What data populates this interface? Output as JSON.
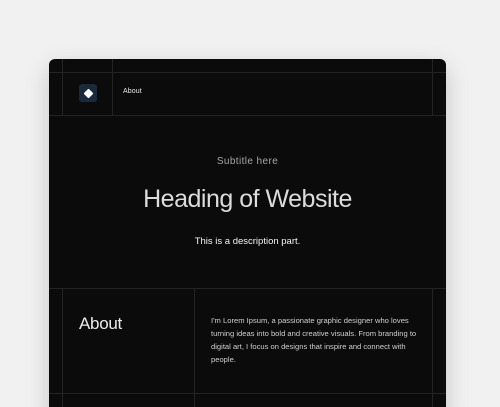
{
  "nav": {
    "logo_icon": "diamond-logo-icon",
    "about_label": "About"
  },
  "hero": {
    "subtitle": "Subtitle here",
    "heading": "Heading of Website",
    "description": "This is a description part."
  },
  "about": {
    "title": "About",
    "body": "I'm Lorem Ipsum, a passionate graphic designer who loves turning ideas into bold and creative visuals. From branding to digital art, I focus on designs that inspire and connect with people."
  },
  "colors": {
    "page_background": "#f1f1f1",
    "window_background": "#0b0b0b",
    "grid_line": "#242424",
    "logo_background": "#1a2a3c"
  }
}
